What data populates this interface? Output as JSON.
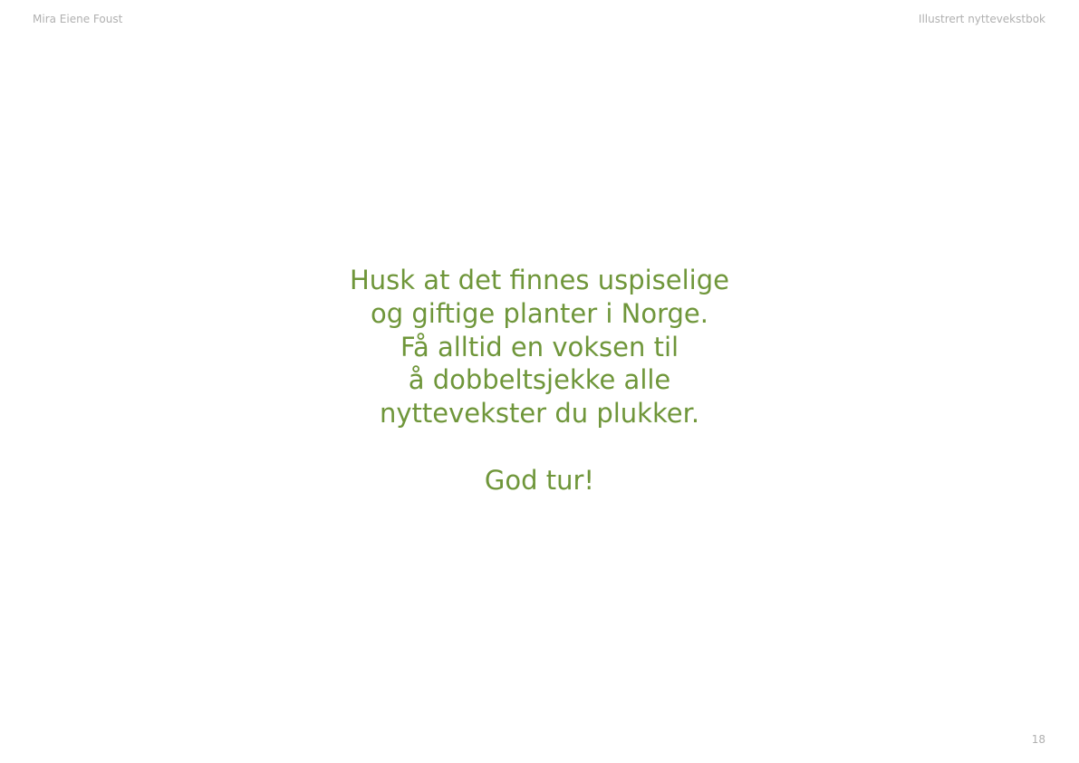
{
  "header": {
    "author": "Mira Eiene Foust",
    "book_title": "Illustrert nyttevekstbok"
  },
  "message": {
    "lines": [
      "Husk at det finnes uspiselige",
      "og giftige planter i Norge.",
      "Få alltid en voksen til",
      "å dobbeltsjekke alle",
      "nyttevekster du plukker."
    ],
    "greeting": "God tur!"
  },
  "footer": {
    "page_number": "18"
  },
  "colors": {
    "accent": "#6f963a",
    "muted": "#b0b0b0"
  }
}
